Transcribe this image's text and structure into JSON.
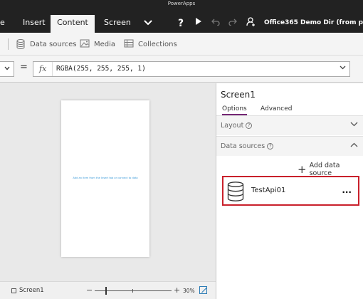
{
  "window": {
    "title": "PowerApps"
  },
  "ribbon": {
    "tabs": [
      {
        "label": "e",
        "active": false
      },
      {
        "label": "Insert",
        "active": false
      },
      {
        "label": "Content",
        "active": true
      },
      {
        "label": "Screen",
        "active": false
      }
    ],
    "help_label": "?",
    "account_label": "Office365 Demo Dir (from previ..."
  },
  "commandbar": {
    "items": [
      {
        "label": "Data sources",
        "icon": "database-icon"
      },
      {
        "label": "Media",
        "icon": "image-icon"
      },
      {
        "label": "Collections",
        "icon": "table-icon"
      }
    ]
  },
  "formula": {
    "equals": "=",
    "fx_label": "fx",
    "value": "RGBA(255, 255, 255, 1)"
  },
  "canvas": {
    "empty_message": "Add an item from the Insert tab or connect to data"
  },
  "statusbar": {
    "screen_label": "Screen1",
    "zoom_minus": "−",
    "zoom_plus": "+",
    "zoom_percent": "30%",
    "zoom_level": 0.3
  },
  "panel": {
    "title": "Screen1",
    "tabs": [
      {
        "label": "Options",
        "active": true
      },
      {
        "label": "Advanced",
        "active": false
      }
    ],
    "layout_label": "Layout",
    "datasources_label": "Data sources",
    "help_glyph": "?",
    "add_datasource_label": "Add data source",
    "datasources": [
      {
        "name": "TestApi01",
        "more": "..."
      }
    ],
    "highlight_color": "#c9202b",
    "accent_color": "#742774"
  }
}
